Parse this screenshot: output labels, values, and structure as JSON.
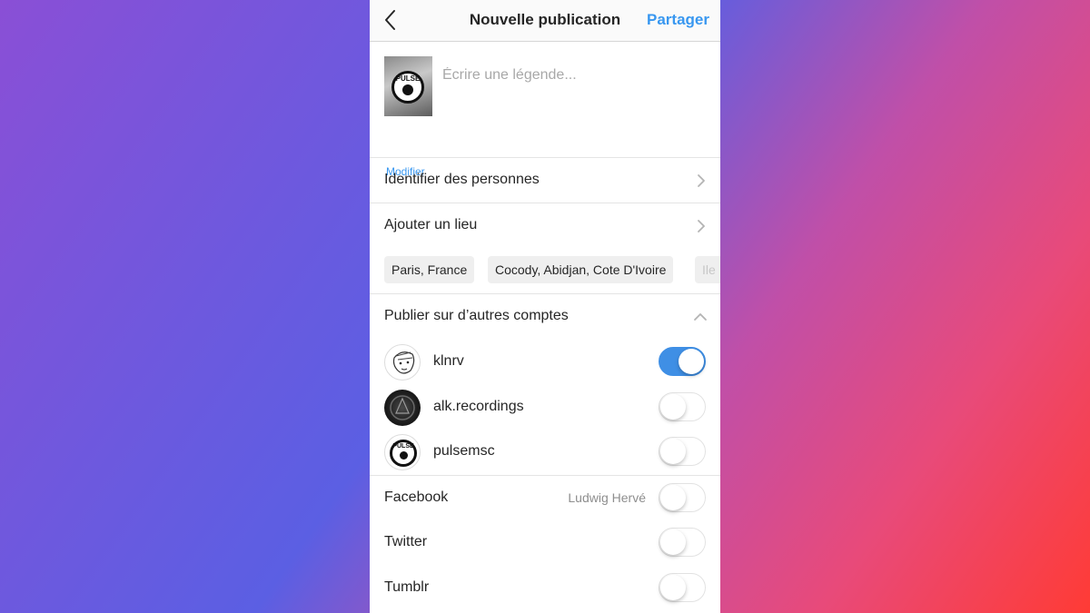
{
  "header": {
    "title": "Nouvelle publication",
    "share_label": "Partager"
  },
  "compose": {
    "caption_placeholder": "Écrire une légende...",
    "modify_label": "Modifier",
    "thumb_text": "PULSE"
  },
  "rows": {
    "tag_people": "Identifier des personnes",
    "add_location": "Ajouter un lieu"
  },
  "location_suggestions": [
    "Paris, France",
    "Cocody, Abidjan, Cote D'Ivoire",
    "Ile"
  ],
  "accounts_section": {
    "title": "Publier sur d’autres comptes",
    "accounts": [
      {
        "name": "klnrv",
        "enabled": true
      },
      {
        "name": "alk.recordings",
        "enabled": false
      },
      {
        "name": "pulsemsc",
        "enabled": false,
        "avatar_text": "PULSE"
      }
    ]
  },
  "social": [
    {
      "name": "Facebook",
      "user": "Ludwig Hervé",
      "enabled": false
    },
    {
      "name": "Twitter",
      "enabled": false
    },
    {
      "name": "Tumblr",
      "enabled": false
    }
  ],
  "colors": {
    "accent": "#3897f0",
    "toggle_on": "#3f8fe5"
  }
}
